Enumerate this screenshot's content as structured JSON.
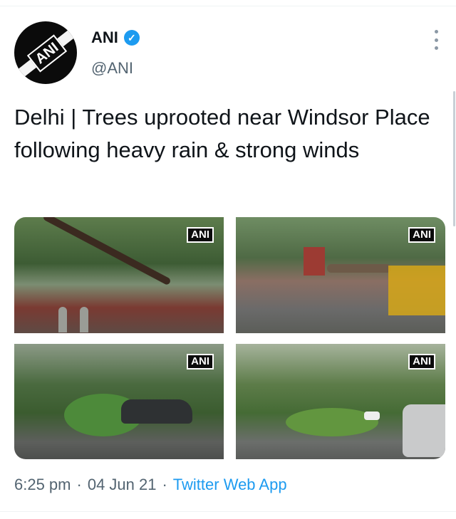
{
  "tweet": {
    "author": {
      "display_name": "ANI",
      "handle": "@ANI",
      "avatar_logo_text": "ANI",
      "verified_icon": "verified-badge-icon"
    },
    "text": "Delhi | Trees uprooted near Windsor Place following heavy rain & strong winds",
    "media": [
      {
        "watermark": "ANI"
      },
      {
        "watermark": "ANI"
      },
      {
        "watermark": "ANI"
      },
      {
        "watermark": "ANI"
      }
    ],
    "meta": {
      "time": "6:25 pm",
      "separator": "·",
      "date": "04 Jun 21",
      "source": "Twitter Web App"
    }
  },
  "colors": {
    "accent": "#1d9bf0",
    "secondary_text": "#536471",
    "primary_text": "#0f1419"
  },
  "icons": {
    "more": "more-options-icon",
    "verified": "verified-badge-icon"
  }
}
